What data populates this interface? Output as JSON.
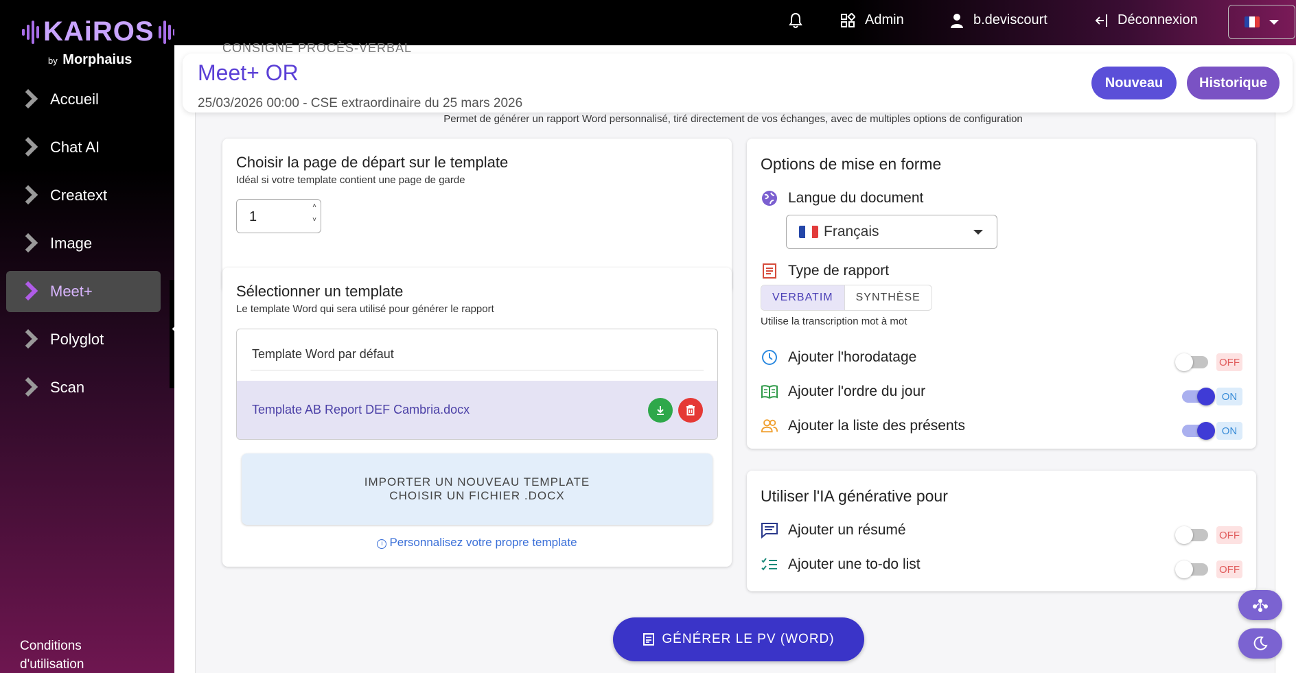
{
  "brand": {
    "name": "KAiROS",
    "sub_prefix": "by",
    "sub_name": "Morphaius"
  },
  "sidebar": {
    "items": [
      {
        "label": "Accueil",
        "icon": "chevron-right-icon"
      },
      {
        "label": "Chat AI",
        "icon": "chevron-right-icon"
      },
      {
        "label": "Creatext",
        "icon": "chevron-right-icon"
      },
      {
        "label": "Image",
        "icon": "chevron-right-icon"
      },
      {
        "label": "Meet+",
        "icon": "chevron-right-icon",
        "active": true
      },
      {
        "label": "Polyglot",
        "icon": "chevron-right-icon"
      },
      {
        "label": "Scan",
        "icon": "chevron-right-icon"
      }
    ],
    "terms_line1": "Conditions",
    "terms_line2": "d'utilisation"
  },
  "topbar": {
    "admin_label": "Admin",
    "user_label": "b.deviscourt",
    "logout_label": "Déconnexion",
    "language": "fr"
  },
  "header": {
    "behind_tabs": "CONSIGNE      PROCÈS-VERBAL",
    "title": "Meet+ OR",
    "subtitle": "25/03/2026 00:00 - CSE extraordinaire du 25 mars 2026",
    "new_button": "Nouveau",
    "history_button": "Historique"
  },
  "description": "Permet de générer un rapport Word personnalisé, tiré directement de vos échanges, avec de multiples options de configuration",
  "start_page": {
    "title": "Choisir la page de départ sur le template",
    "subtitle": "Idéal si votre template contient une page de garde",
    "value": "1"
  },
  "template": {
    "title": "Sélectionner un template",
    "subtitle": "Le template Word qui sera utilisé pour générer le rapport",
    "default_item": "Template Word par défaut",
    "selected_item": "Template AB Report DEF Cambria.docx",
    "import_line1": "IMPORTER UN NOUVEAU TEMPLATE",
    "import_line2": "CHOISIR UN FICHIER .DOCX",
    "custom_link": "Personnalisez votre propre template"
  },
  "formatting": {
    "title": "Options de mise en forme",
    "language_label": "Langue du document",
    "language_value": "Français",
    "report_type_label": "Type de rapport",
    "report_types": [
      "VERBATIM",
      "SYNTHÈSE"
    ],
    "report_type_selected": "VERBATIM",
    "report_type_hint": "Utilise la transcription mot à mot",
    "options": [
      {
        "label": "Ajouter l'horodatage",
        "state": "OFF"
      },
      {
        "label": "Ajouter l'ordre du jour",
        "state": "ON"
      },
      {
        "label": "Ajouter la liste des présents",
        "state": "ON"
      }
    ]
  },
  "ai": {
    "title": "Utiliser l'IA générative pour",
    "options": [
      {
        "label": "Ajouter un résumé",
        "state": "OFF"
      },
      {
        "label": "Ajouter une to-do list",
        "state": "OFF"
      }
    ]
  },
  "generate_button": "GÉNÉRER LE PV (WORD)",
  "colors": {
    "accent": "#3a34c8",
    "title": "#5a3fd6",
    "nouveau": "#5b4fd8",
    "historique": "#7a52c4",
    "download": "#2ea84a",
    "delete": "#e53935"
  }
}
